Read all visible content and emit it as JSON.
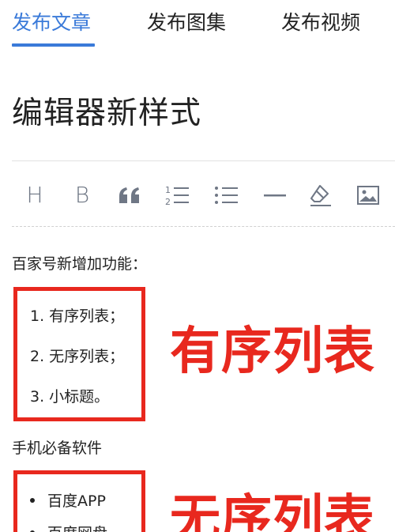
{
  "tabs": [
    {
      "label": "发布文章",
      "active": true
    },
    {
      "label": "发布图集",
      "active": false
    },
    {
      "label": "发布视频",
      "active": false
    }
  ],
  "accent_color": "#3a7ad9",
  "annotation_color": "#e8281e",
  "editor": {
    "title": "编辑器新样式",
    "toolbar": [
      {
        "name": "heading-icon",
        "label": "H"
      },
      {
        "name": "bold-icon",
        "label": "B"
      },
      {
        "name": "quote-icon"
      },
      {
        "name": "ordered-list-icon"
      },
      {
        "name": "unordered-list-icon"
      },
      {
        "name": "horizontal-rule-icon"
      },
      {
        "name": "eraser-icon"
      },
      {
        "name": "image-icon"
      }
    ],
    "content": {
      "paragraph_1": "百家号新增加功能：",
      "ordered_list": [
        "1. 有序列表；",
        "2. 无序列表；",
        "3. 小标题。"
      ],
      "paragraph_2": "手机必备软件",
      "unordered_list": [
        "百度APP",
        "百度网盘"
      ]
    }
  },
  "annotations": {
    "ordered": "有序列表",
    "unordered": "无序列表"
  }
}
